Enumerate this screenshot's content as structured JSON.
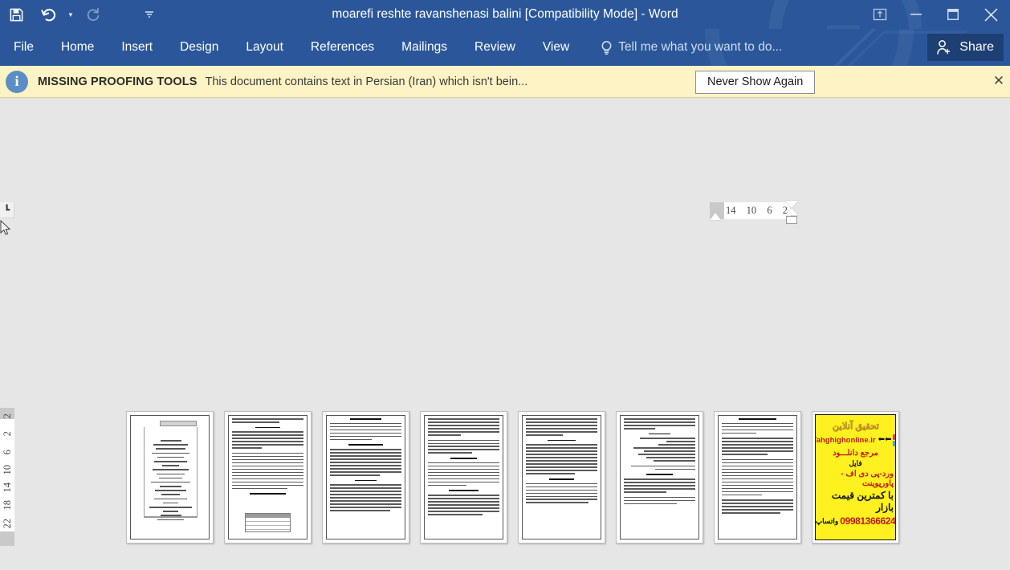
{
  "titlebar": {
    "document_title": "moarefi reshte ravanshenasi balini [Compatibility Mode] - Word",
    "quick_access": [
      {
        "name": "save-icon",
        "label": "Save"
      },
      {
        "name": "undo-icon",
        "label": "Undo"
      },
      {
        "name": "redo-icon",
        "label": "Redo"
      },
      {
        "name": "customize-qat-icon",
        "label": "Customize Quick Access Toolbar"
      }
    ],
    "window_controls": [
      {
        "name": "ribbon-display-options-icon",
        "label": "Ribbon Display Options"
      },
      {
        "name": "minimize-icon",
        "label": "Minimize"
      },
      {
        "name": "restore-icon",
        "label": "Restore Down"
      },
      {
        "name": "close-icon",
        "label": "Close"
      }
    ]
  },
  "ribbon": {
    "tabs": [
      {
        "label": "File"
      },
      {
        "label": "Home"
      },
      {
        "label": "Insert"
      },
      {
        "label": "Design"
      },
      {
        "label": "Layout"
      },
      {
        "label": "References"
      },
      {
        "label": "Mailings"
      },
      {
        "label": "Review"
      },
      {
        "label": "View"
      }
    ],
    "tell_me_placeholder": "Tell me what you want to do...",
    "share_label": "Share",
    "accent_color": "#2b579a",
    "share_bg": "#1e3f73"
  },
  "notification": {
    "title": "MISSING PROOFING TOOLS",
    "message": "This document contains text in Persian (Iran) which isn't bein...",
    "button_label": "Never Show Again",
    "close_label": "✕",
    "bg_color": "#fdf3c4",
    "info_icon": "i"
  },
  "rulers": {
    "horizontal_ticks": [
      "14",
      "10",
      "6",
      "2"
    ],
    "vertical_ticks": [
      "2",
      "2",
      "6",
      "10",
      "14",
      "18",
      "22"
    ],
    "tab_stop_glyph": "┗"
  },
  "workspace": {
    "zoom_mode": "multiple-pages",
    "page_count": 8,
    "pages": [
      {
        "index": 1,
        "kind": "table-of-contents",
        "description": "Table of contents page with bordered index frame",
        "line_widths": [
          52,
          78,
          66,
          80,
          58,
          70,
          42,
          74,
          62,
          54,
          80,
          50,
          68,
          44,
          72,
          40,
          86,
          34,
          48,
          58
        ]
      },
      {
        "index": 2,
        "kind": "persian-text-with-table",
        "description": "Persian body text with small table at page bottom",
        "paragraphs": [
          3,
          8,
          13
        ],
        "has_table": true
      },
      {
        "index": 3,
        "kind": "persian-text",
        "description": "Persian body text with headings",
        "paragraphs": [
          2,
          9,
          10,
          7
        ]
      },
      {
        "index": 4,
        "kind": "persian-text",
        "description": "Persian body text, dense",
        "paragraphs": [
          6,
          5,
          8,
          7
        ]
      },
      {
        "index": 5,
        "kind": "persian-text",
        "description": "Persian body text, dense",
        "paragraphs": [
          5,
          9,
          10,
          6
        ]
      },
      {
        "index": 6,
        "kind": "persian-list",
        "description": "Persian text with numbered list entries",
        "paragraphs": [
          4,
          9,
          5,
          6
        ]
      },
      {
        "index": 7,
        "kind": "persian-text",
        "description": "Persian body text, dense",
        "paragraphs": [
          4,
          6,
          12,
          6
        ]
      },
      {
        "index": 8,
        "kind": "advertisement",
        "description": "Yellow advertisement back page",
        "ad": {
          "logo_text": "تحقیق آنلاین",
          "site": "Tahghighonline.ir",
          "line_red_1": "مرجع دانلـــود",
          "line_black_1": "فایل",
          "line_red_2": "ورد-پی دی اف - پاورپوینت",
          "line_black_2": "با کمترین قیمت بازار",
          "phone": "09981366624",
          "phone_label": "واتساپ",
          "bg_color": "#fff01f",
          "red_color": "#c21b17",
          "gold_color": "#c9972a"
        }
      }
    ]
  }
}
